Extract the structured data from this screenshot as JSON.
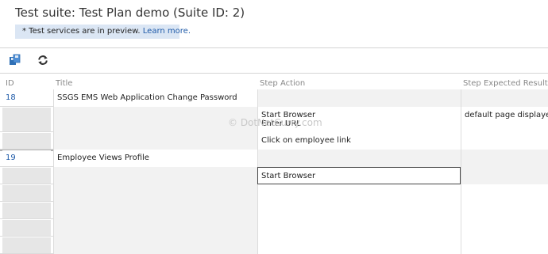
{
  "header": {
    "suite_title": "Test suite: Test Plan demo (Suite ID: 2)",
    "preview_text": "* Test services are in preview.",
    "preview_link": "Learn more."
  },
  "toolbar": [
    {
      "name": "save-icon",
      "icon": "save-icon"
    },
    {
      "name": "refresh-icon",
      "icon": "refresh-icon"
    }
  ],
  "columns": [
    "ID",
    "Title",
    "Step Action",
    "Step Expected Result"
  ],
  "test_cases": [
    {
      "id": "18",
      "title": "SSGS EMS Web Application Change Password",
      "steps": [
        {
          "action_lines": [
            "Start Browser",
            "Enter URL"
          ],
          "expected": "default page displayed"
        },
        {
          "action_lines": [
            "Click on employee link"
          ],
          "expected": ""
        }
      ]
    },
    {
      "id": "19",
      "title": "Employee Views Profile",
      "steps": [
        {
          "action_lines": [
            "Start Browser"
          ],
          "expected": ""
        }
      ]
    }
  ],
  "watermark": "© DotNetCurry.com",
  "colors": {
    "link": "#1e5aa8",
    "banner": "#dbe6f4",
    "gutter": "#e6e6e6",
    "row_shade": "#f2f2f2"
  }
}
